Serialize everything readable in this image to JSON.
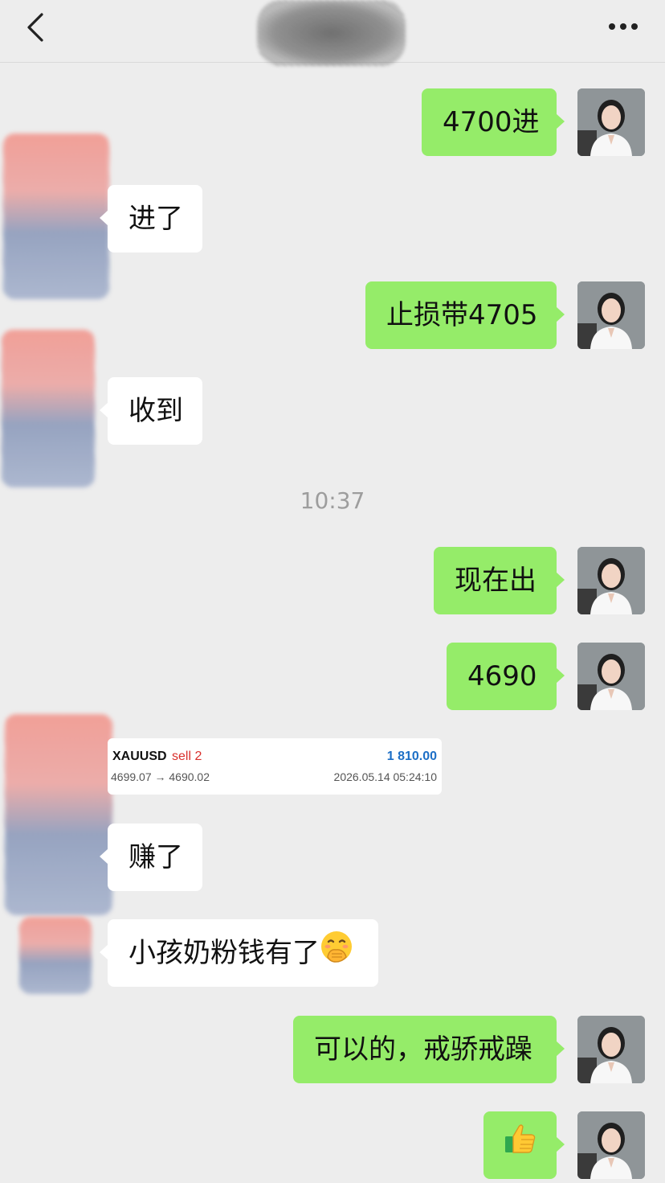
{
  "header": {
    "back_icon": "chevron-left-icon",
    "more_icon": "more-dots-icon"
  },
  "messages": [
    {
      "side": "out",
      "text": "4700进"
    },
    {
      "side": "in",
      "text": "进了"
    },
    {
      "side": "out",
      "text": "止损带4705"
    },
    {
      "side": "in",
      "text": "收到"
    },
    {
      "side": "out",
      "text": "现在出"
    },
    {
      "side": "out",
      "text": "4690"
    },
    {
      "side": "in",
      "text": "赚了"
    },
    {
      "side": "in",
      "text": "小孩奶粉钱有了",
      "emoji": "face-with-hand-over-mouth-icon"
    },
    {
      "side": "out",
      "text": "可以的，戒骄戒躁"
    },
    {
      "side": "out",
      "text": "",
      "emoji": "thumbs-up-icon"
    }
  ],
  "timestamp": "10:37",
  "trade_card": {
    "symbol": "XAUUSD",
    "side": "sell 2",
    "profit": "1 810.00",
    "prices": "4699.07 → 4690.02",
    "time": "2026.05.14 05:24:10"
  },
  "colors": {
    "background": "#ededed",
    "out_bubble": "#95ec69",
    "in_bubble": "#ffffff",
    "sell": "#d9302c",
    "profit": "#1d6fc6"
  }
}
